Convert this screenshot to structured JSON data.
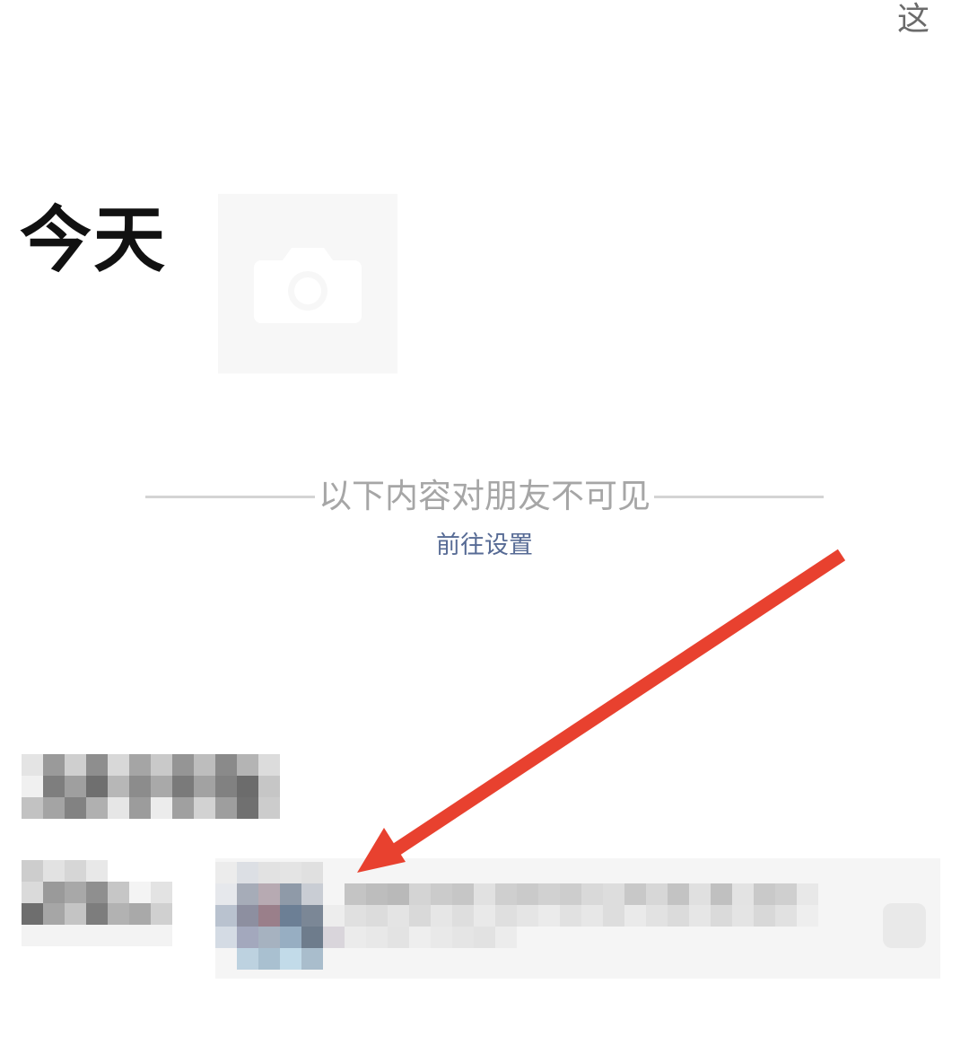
{
  "header": {
    "corner_char": "这"
  },
  "moments": {
    "date_label": "今天",
    "camera_icon": "camera-icon"
  },
  "privacy_notice": {
    "divider_text": "以下内容对朋友不可见",
    "link_label": "前往设置"
  },
  "colors": {
    "link": "#576b95",
    "arrow": "#e8412f",
    "divider": "#d4d4d4"
  }
}
